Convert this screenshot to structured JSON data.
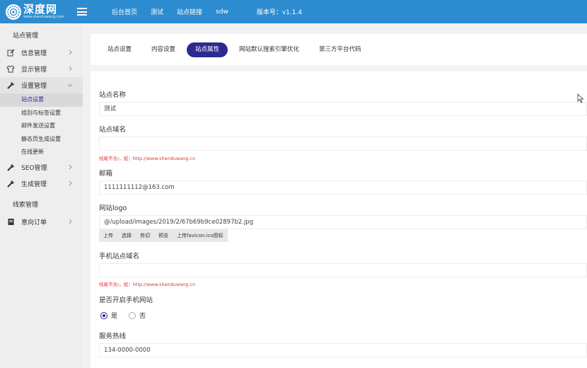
{
  "app": {
    "logo_text": "深度网",
    "logo_sub": "www.shenduwang.com",
    "brand_color": "#2d8ccf",
    "accent_color": "#2b2b8f"
  },
  "topnav": {
    "items": [
      "后台首页",
      "测试",
      "站点链接",
      "sdw"
    ],
    "version": "版本号：v1.1.4"
  },
  "sidebar": {
    "header1": "站点管理",
    "items": [
      {
        "label": "信息管理",
        "icon": "edit-icon"
      },
      {
        "label": "显示管理",
        "icon": "shirt-icon"
      },
      {
        "label": "设置管理",
        "icon": "wrench-icon"
      }
    ],
    "subitems": [
      "站点设置",
      "组别与标签设置",
      "邮件发送设置",
      "静态页生成设置",
      "在线更新"
    ],
    "items2": [
      {
        "label": "SEO管理",
        "icon": "wrench-icon"
      },
      {
        "label": "生成管理",
        "icon": "wrench-icon"
      }
    ],
    "header2": "线索管理",
    "items3": [
      {
        "label": "意向订单",
        "icon": "order-icon"
      }
    ]
  },
  "tabs": [
    "站点设置",
    "内容设置",
    "站点属性",
    "网站默认搜索引擎优化",
    "第三方平台代码"
  ],
  "form": {
    "site_name_label": "站点名称",
    "site_name_value": "测试",
    "site_domain_label": "站点域名",
    "site_domain_value": "",
    "site_domain_hint": "结尾不含/，如：http://www.shenduwang.cn",
    "email_label": "邮箱",
    "email_value": "1111111112@163.com",
    "logo_label": "网站logo",
    "logo_value": "@/upload/images/2019/2/67b69b9ce02897b2.jpg",
    "upload_buttons": [
      "上传",
      "选择",
      "剪切",
      "预览",
      "上传favicon.ico图标"
    ],
    "mobile_domain_label": "手机站点域名",
    "mobile_domain_value": "",
    "mobile_domain_hint": "结尾不含/，如：http://www.shenduwang.cn",
    "mobile_enable_label": "是否开启手机网站",
    "radio_yes": "是",
    "radio_no": "否",
    "hotline_label": "服务热线",
    "hotline_value": "134-0000-0000"
  }
}
